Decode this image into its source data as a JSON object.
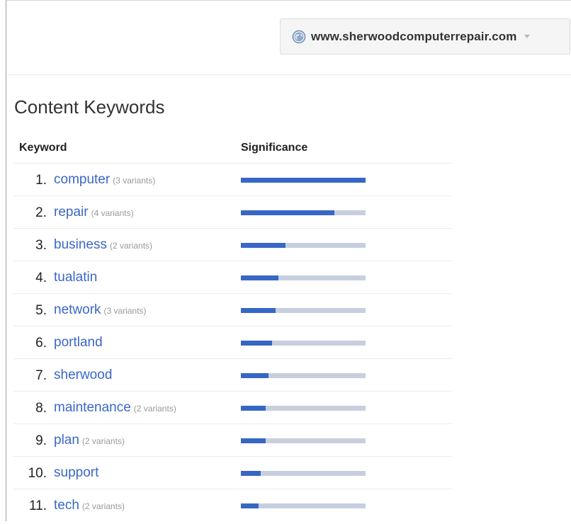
{
  "header": {
    "site_url": "www.sherwoodcomputerrepair.com",
    "globe_icon": "globe-icon",
    "dropdown_icon": "caret-down-icon"
  },
  "section": {
    "title": "Content Keywords",
    "columns": {
      "keyword": "Keyword",
      "significance": "Significance"
    }
  },
  "keywords": [
    {
      "rank": "1.",
      "word": "computer",
      "variants": "(3 variants)",
      "significance": 1.0
    },
    {
      "rank": "2.",
      "word": "repair",
      "variants": "(4 variants)",
      "significance": 0.75
    },
    {
      "rank": "3.",
      "word": "business",
      "variants": "(2 variants)",
      "significance": 0.36
    },
    {
      "rank": "4.",
      "word": "tualatin",
      "variants": "",
      "significance": 0.3
    },
    {
      "rank": "5.",
      "word": "network",
      "variants": "(3 variants)",
      "significance": 0.28
    },
    {
      "rank": "6.",
      "word": "portland",
      "variants": "",
      "significance": 0.25
    },
    {
      "rank": "7.",
      "word": "sherwood",
      "variants": "",
      "significance": 0.22
    },
    {
      "rank": "8.",
      "word": "maintenance",
      "variants": "(2 variants)",
      "significance": 0.2
    },
    {
      "rank": "9.",
      "word": "plan",
      "variants": "(2 variants)",
      "significance": 0.2
    },
    {
      "rank": "10.",
      "word": "support",
      "variants": "",
      "significance": 0.16
    },
    {
      "rank": "11.",
      "word": "tech",
      "variants": "(2 variants)",
      "significance": 0.14
    }
  ],
  "colors": {
    "link": "#3a67c8",
    "bar_fill": "#3766c6",
    "bar_track": "#c7cfdf"
  }
}
